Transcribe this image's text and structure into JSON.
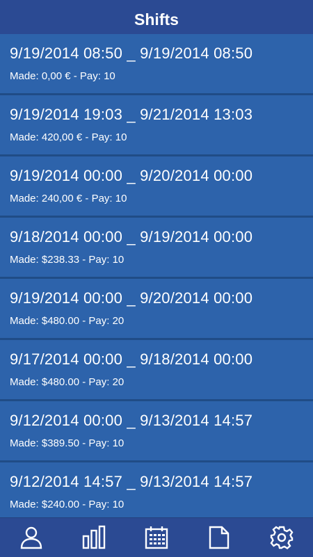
{
  "header": {
    "title": "Shifts"
  },
  "shifts": [
    {
      "range": "9/19/2014 08:50 _ 9/19/2014 08:50",
      "made": "Made: 0,00 € - Pay: 10"
    },
    {
      "range": "9/19/2014 19:03 _ 9/21/2014 13:03",
      "made": "Made: 420,00 € - Pay: 10"
    },
    {
      "range": "9/19/2014 00:00 _ 9/20/2014 00:00",
      "made": "Made: 240,00 € - Pay: 10"
    },
    {
      "range": "9/18/2014 00:00 _ 9/19/2014 00:00",
      "made": "Made: $238.33 - Pay: 10"
    },
    {
      "range": "9/19/2014 00:00 _ 9/20/2014 00:00",
      "made": "Made: $480.00 - Pay: 20"
    },
    {
      "range": "9/17/2014 00:00 _ 9/18/2014 00:00",
      "made": "Made: $480.00 - Pay: 20"
    },
    {
      "range": "9/12/2014 00:00 _ 9/13/2014 14:57",
      "made": "Made: $389.50 - Pay: 10"
    },
    {
      "range": "9/12/2014 14:57 _ 9/13/2014 14:57",
      "made": "Made: $240.00 - Pay: 10"
    }
  ],
  "nav": {
    "items": [
      {
        "icon": "person-icon"
      },
      {
        "icon": "bar-chart-icon"
      },
      {
        "icon": "calendar-icon"
      },
      {
        "icon": "document-icon"
      },
      {
        "icon": "gear-icon"
      }
    ]
  },
  "colors": {
    "header_bg": "#2b4a93",
    "row_bg": "#2d63ab",
    "divider": "#204c86",
    "text": "#ffffff"
  }
}
